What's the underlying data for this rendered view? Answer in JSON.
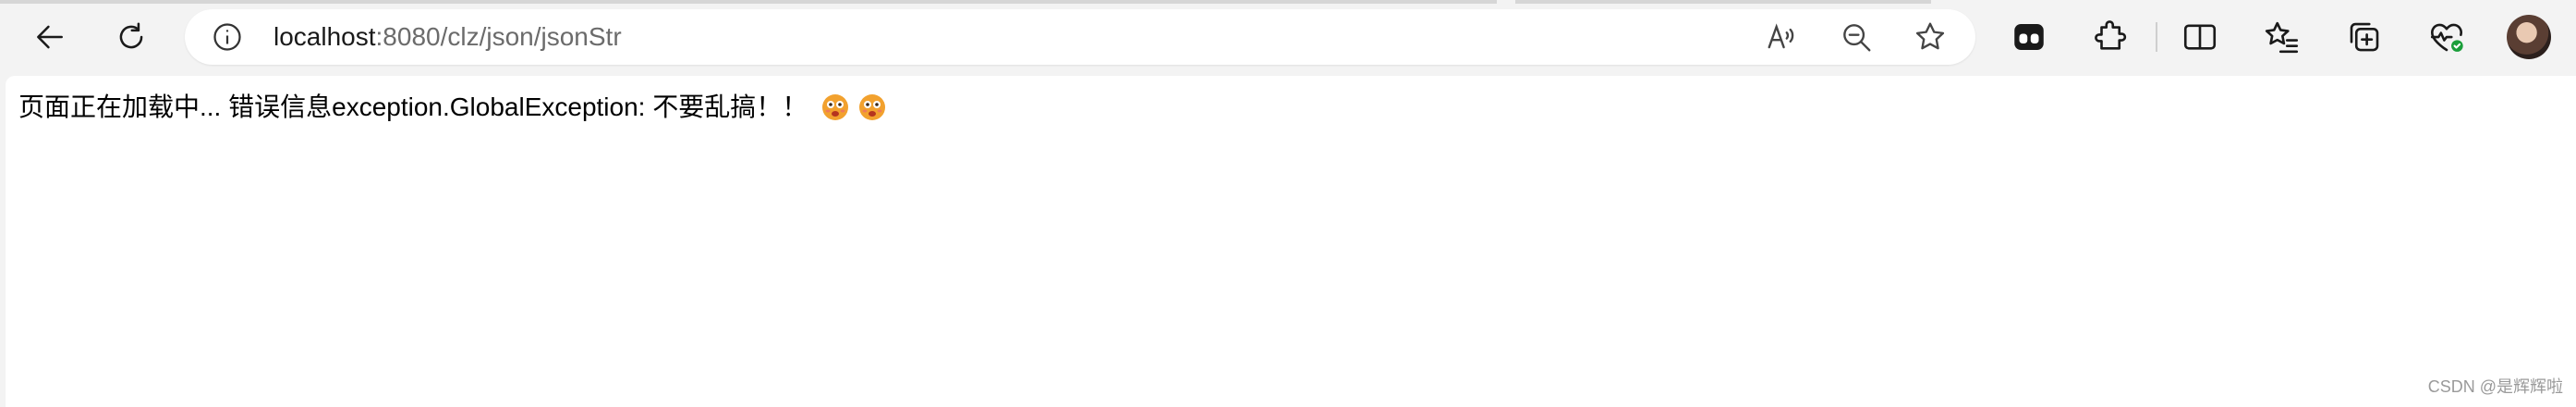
{
  "browser": {
    "url_host": "localhost",
    "url_path": ":8080/clz/json/jsonStr",
    "icons": {
      "back": "back-arrow-icon",
      "refresh": "refresh-icon",
      "site_info": "info-icon",
      "read_aloud": "read-aloud-icon",
      "zoom": "zoom-out-icon",
      "favorite": "star-icon",
      "extension_app": "extension-app-icon",
      "extensions": "puzzle-icon",
      "split_screen": "split-screen-icon",
      "favorites_list": "favorites-icon",
      "collections": "collections-icon",
      "browser_essentials": "heart-pulse-icon",
      "profile": "avatar"
    }
  },
  "page": {
    "message": "页面正在加载中... 错误信息exception.GlobalException: 不要乱搞！！",
    "emoji_count": 2
  },
  "watermark": "CSDN @是辉辉啦",
  "colors": {
    "toolbar_bg": "#f3f3f3",
    "page_bg": "#ffffff",
    "emoji": "#f2a12e",
    "status_green": "#1a9e3a"
  }
}
